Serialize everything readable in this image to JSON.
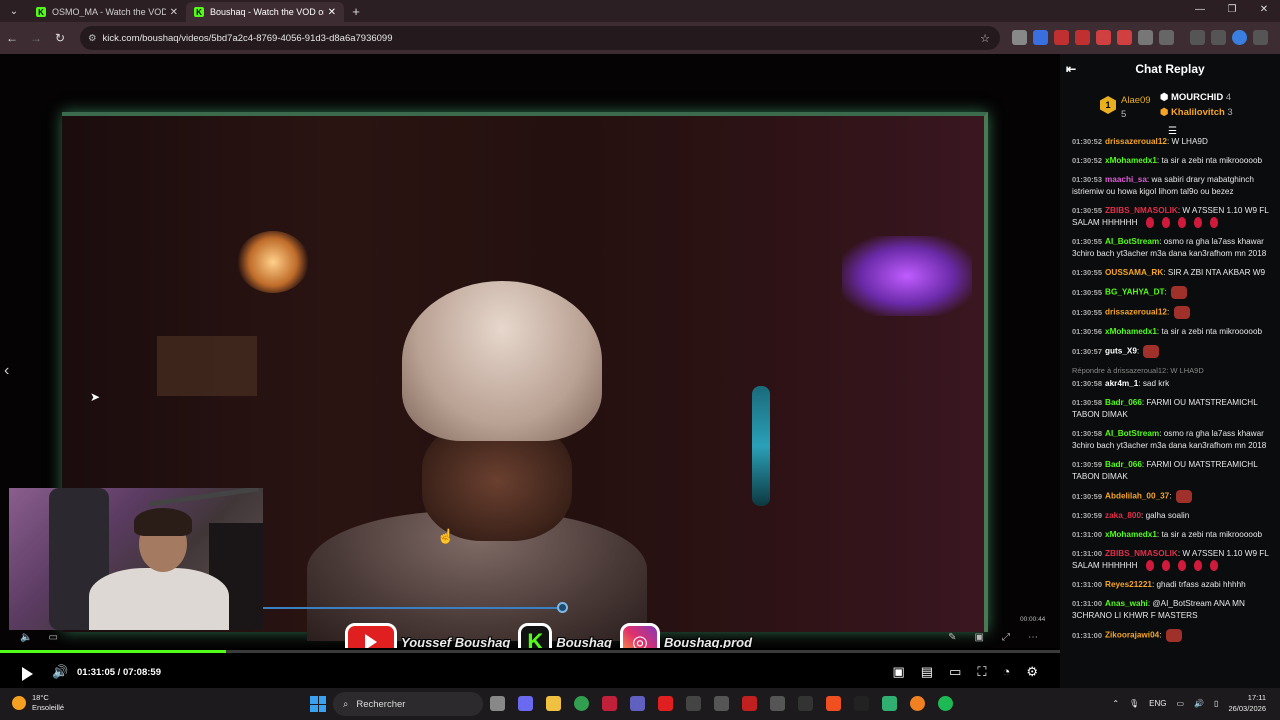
{
  "browser": {
    "tabs": [
      {
        "title": "OSMO_MA - Watch the VOD on Kick",
        "active": false
      },
      {
        "title": "Boushaq - Watch the VOD on Kick",
        "active": true
      }
    ],
    "url": "kick.com/boushaq/videos/5bd7a2c4-8769-4056-91d3-d8a6a7936099"
  },
  "player": {
    "current_time": "01:31:05",
    "separator": "/",
    "duration": "07:08:59",
    "progress_fraction": 0.213,
    "inner_time": "00:00:44",
    "social": {
      "youtube_name": "Youssef Boushaq",
      "kick_name": "Boushaq",
      "instagram_name": "Boushaq.prod"
    }
  },
  "chat": {
    "title": "Chat Replay",
    "leaderboard": [
      {
        "name": "Alae09",
        "count": "5",
        "rank": "1"
      },
      {
        "name": "MOURCHID",
        "count": "4"
      },
      {
        "name": "Khalilovitch",
        "count": "3"
      }
    ],
    "messages": [
      {
        "time": "01:30:52",
        "user": "drissazeroual12",
        "color": "#f5a524",
        "text": "W LHA9D"
      },
      {
        "time": "01:30:52",
        "user": "xMohamedx1",
        "color": "#53fc18",
        "text": "ta sir a zebi nta mikrooooob"
      },
      {
        "time": "01:30:53",
        "user": "maachi_sa",
        "color": "#e05cd8",
        "text": "wa sabiri drary mabatghinch istriemiw ou howa kigol lihom tal9o ou bezez"
      },
      {
        "time": "01:30:55",
        "user": "ZBIBS_NMASOLIK",
        "color": "#e0304a",
        "text": "W A7SSEN 1.10 W9 FL SALAM HHHHHH",
        "drops": 5
      },
      {
        "time": "01:30:55",
        "user": "AI_BotStream",
        "color": "#53fc18",
        "text": "osmo ra gha la7ass khawar 3chiro bach yt3acher m3a dana kan3rafhom mn 2018"
      },
      {
        "time": "01:30:55",
        "user": "OUSSAMA_RK",
        "color": "#f5a524",
        "text": "SIR A ZBI NTA AKBAR W9"
      },
      {
        "time": "01:30:55",
        "user": "BG_YAHYA_DT",
        "color": "#53fc18",
        "text": "",
        "emote": true
      },
      {
        "time": "01:30:55",
        "user": "drissazeroual12",
        "color": "#f5a524",
        "text": "",
        "emote": true
      },
      {
        "time": "01:30:56",
        "user": "xMohamedx1",
        "color": "#53fc18",
        "text": "ta sir a zebi nta mikrooooob"
      },
      {
        "time": "01:30:57",
        "user": "guts_X9",
        "color": "#ffffff",
        "text": "",
        "emote": true
      },
      {
        "time": "01:30:58",
        "reply": "Répondre à drissazeroual12: W LHA9D",
        "user": "akr4m_1",
        "color": "#ffffff",
        "text": "sad krk"
      },
      {
        "time": "01:30:58",
        "user": "Badr_066",
        "color": "#53fc18",
        "text": "FARMI OU MATSTREAMICHL TABON DIMAK"
      },
      {
        "time": "01:30:58",
        "user": "AI_BotStream",
        "color": "#53fc18",
        "text": "osmo ra gha la7ass khawar 3chiro bach yt3acher m3a dana kan3rafhom mn 2018"
      },
      {
        "time": "01:30:59",
        "user": "Badr_066",
        "color": "#53fc18",
        "text": "FARMI OU MATSTREAMICHL TABON DIMAK"
      },
      {
        "time": "01:30:59",
        "user": "Abdelilah_00_37",
        "color": "#f5a524",
        "text": "",
        "emote": true
      },
      {
        "time": "01:30:59",
        "user": "zaka_800",
        "color": "#e0304a",
        "text": "galha soalin"
      },
      {
        "time": "01:31:00",
        "user": "xMohamedx1",
        "color": "#53fc18",
        "text": "ta sir a zebi nta mikrooooob"
      },
      {
        "time": "01:31:00",
        "user": "ZBIBS_NMASOLIK",
        "color": "#e0304a",
        "text": "W A7SSEN 1.10 W9 FL SALAM HHHHHH",
        "drops": 5
      },
      {
        "time": "01:31:00",
        "user": "Reyes21221",
        "color": "#f5a524",
        "text": "ghadi trfass azabi hhhhh"
      },
      {
        "time": "01:31:00",
        "user": "Anas_wahi",
        "color": "#53fc18",
        "text": "@AI_BotStream ANA MN 3CHRANO LI KHWR F MASTERS"
      },
      {
        "time": "01:31:00",
        "user": "Zikoorajawi04",
        "color": "#f5a524",
        "text": "",
        "emote": true
      }
    ]
  },
  "taskbar": {
    "temperature": "18°C",
    "weather": "Ensoleillé",
    "search_placeholder": "Rechercher",
    "lang": "ENG",
    "time": "17:11",
    "date": "26/03/2026"
  }
}
